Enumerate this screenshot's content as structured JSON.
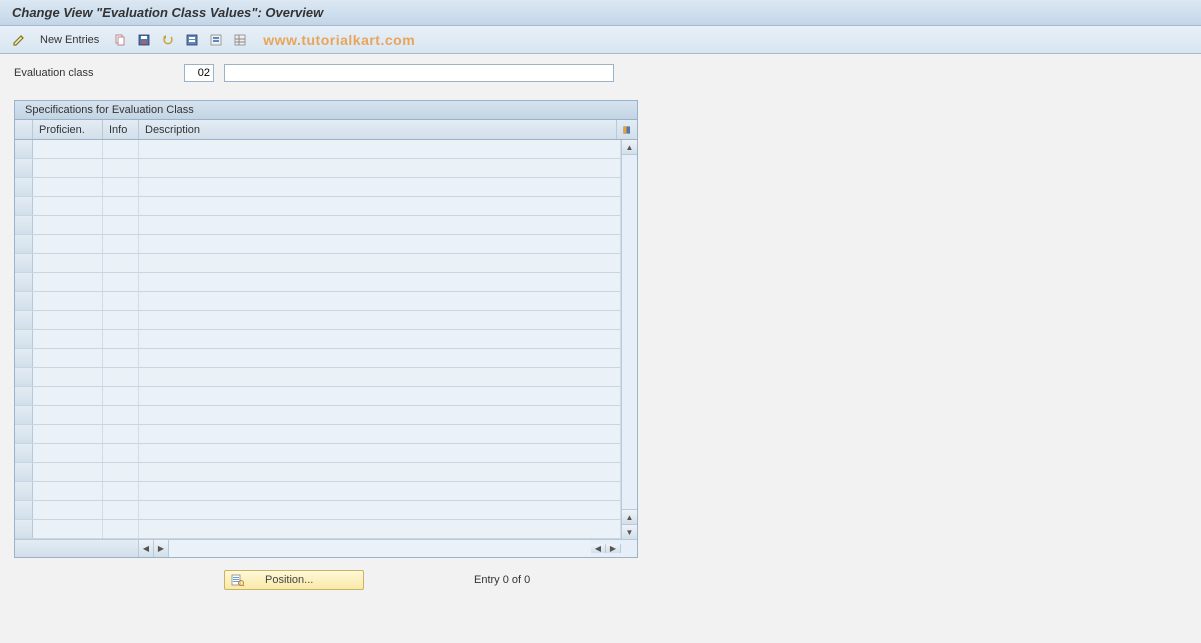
{
  "title": "Change View \"Evaluation Class Values\": Overview",
  "toolbar": {
    "new_entries": "New Entries"
  },
  "watermark": "www.tutorialkart.com",
  "fields": {
    "eval_class_label": "Evaluation class",
    "eval_class_value": "02",
    "eval_class_desc": ""
  },
  "panel": {
    "title": "Specifications for Evaluation Class",
    "columns": {
      "proficien": "Proficien.",
      "info": "Info",
      "description": "Description"
    },
    "rows": [
      {
        "proficien": "",
        "info": "",
        "description": ""
      },
      {
        "proficien": "",
        "info": "",
        "description": ""
      },
      {
        "proficien": "",
        "info": "",
        "description": ""
      },
      {
        "proficien": "",
        "info": "",
        "description": ""
      },
      {
        "proficien": "",
        "info": "",
        "description": ""
      },
      {
        "proficien": "",
        "info": "",
        "description": ""
      },
      {
        "proficien": "",
        "info": "",
        "description": ""
      },
      {
        "proficien": "",
        "info": "",
        "description": ""
      },
      {
        "proficien": "",
        "info": "",
        "description": ""
      },
      {
        "proficien": "",
        "info": "",
        "description": ""
      },
      {
        "proficien": "",
        "info": "",
        "description": ""
      },
      {
        "proficien": "",
        "info": "",
        "description": ""
      },
      {
        "proficien": "",
        "info": "",
        "description": ""
      },
      {
        "proficien": "",
        "info": "",
        "description": ""
      },
      {
        "proficien": "",
        "info": "",
        "description": ""
      },
      {
        "proficien": "",
        "info": "",
        "description": ""
      },
      {
        "proficien": "",
        "info": "",
        "description": ""
      },
      {
        "proficien": "",
        "info": "",
        "description": ""
      },
      {
        "proficien": "",
        "info": "",
        "description": ""
      },
      {
        "proficien": "",
        "info": "",
        "description": ""
      },
      {
        "proficien": "",
        "info": "",
        "description": ""
      }
    ]
  },
  "footer": {
    "position_label": "Position...",
    "entry_text": "Entry 0 of 0"
  }
}
